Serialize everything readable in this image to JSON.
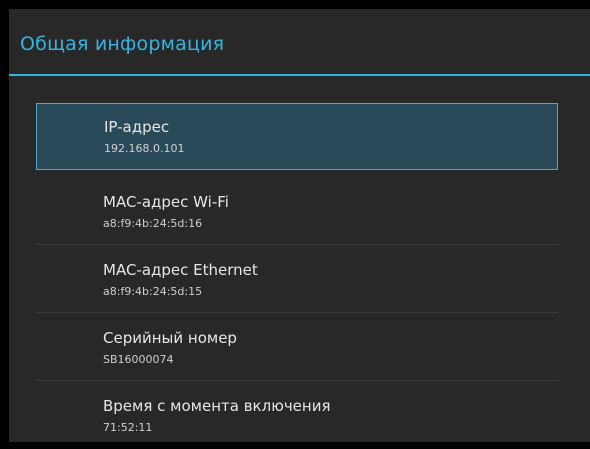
{
  "dialog": {
    "title": "Общая информация"
  },
  "items": [
    {
      "title": "IP-адрес",
      "value": "192.168.0.101"
    },
    {
      "title": "MAC-адрес Wi-Fi",
      "value": "a8:f9:4b:24:5d:16"
    },
    {
      "title": "MAC-адрес Ethernet",
      "value": "a8:f9:4b:24:5d:15"
    },
    {
      "title": "Серийный номер",
      "value": "SB16000074"
    },
    {
      "title": "Время с момента включения",
      "value": "71:52:11"
    }
  ],
  "colors": {
    "accent": "#33b5e5",
    "background": "#282828",
    "selected_background": "#2a4a5a",
    "selected_border": "#4fa9cc"
  }
}
